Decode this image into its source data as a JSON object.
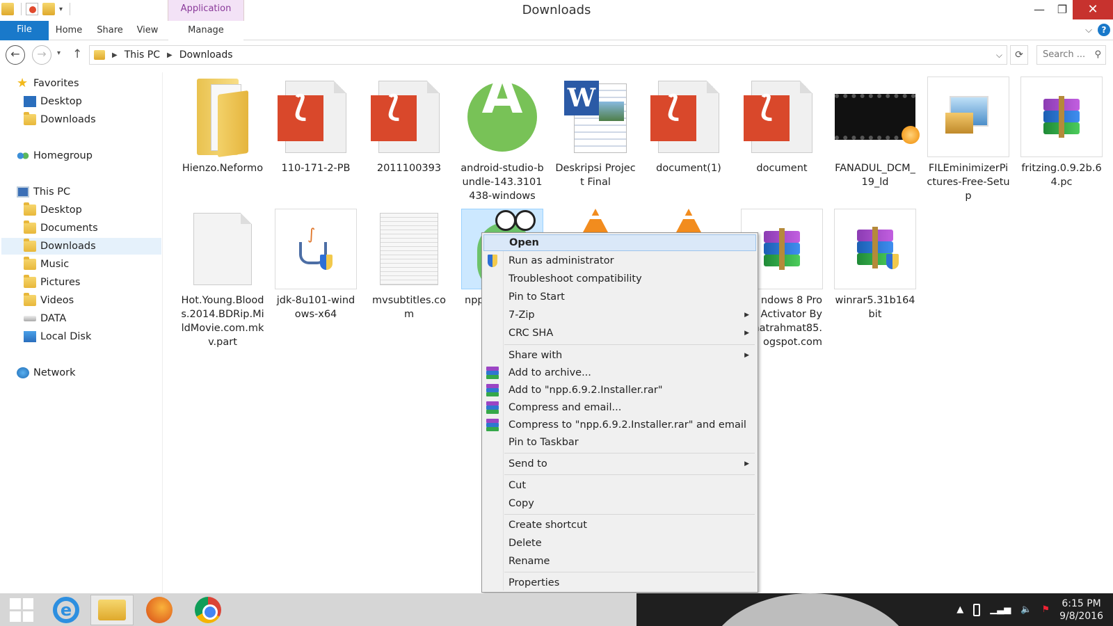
{
  "window": {
    "title": "Downloads",
    "context_tab_group": "Application Tools",
    "controls": {
      "minimize": "—",
      "maximize": "❐",
      "close": "✕"
    }
  },
  "ribbon": {
    "tabs": [
      {
        "label": "File"
      },
      {
        "label": "Home"
      },
      {
        "label": "Share"
      },
      {
        "label": "View"
      },
      {
        "label": "Manage"
      }
    ],
    "help": "?"
  },
  "address": {
    "breadcrumbs": [
      "This PC",
      "Downloads"
    ],
    "search_placeholder": "Search ..."
  },
  "sidebar": {
    "favorites": {
      "label": "Favorites",
      "items": [
        "Desktop",
        "Downloads"
      ]
    },
    "homegroup": "Homegroup",
    "thispc": {
      "label": "This PC",
      "items": [
        "Desktop",
        "Documents",
        "Downloads",
        "Music",
        "Pictures",
        "Videos",
        "DATA",
        "Local Disk"
      ]
    },
    "network": "Network",
    "selected": "Downloads"
  },
  "files": {
    "row1": [
      {
        "name": "Hienzo.Neformo",
        "icon": "folder-icon"
      },
      {
        "name": "110-171-2-PB",
        "icon": "pdf-icon"
      },
      {
        "name": "2011100393",
        "icon": "pdf-icon"
      },
      {
        "name": "android-studio-bundle-143.3101438-windows",
        "icon": "android-studio-icon"
      },
      {
        "name": "Deskripsi Project Final",
        "icon": "word-icon"
      },
      {
        "name": "document(1)",
        "icon": "pdf-icon"
      },
      {
        "name": "document",
        "icon": "pdf-icon"
      },
      {
        "name": "FANADUL_DCM_19_ld",
        "icon": "video-icon"
      },
      {
        "name": "FILEminimizerPictures-Free-Setup",
        "icon": "installer-icon"
      },
      {
        "name": "fritzing.0.9.2b.64.pc",
        "icon": "winrar-archive-icon"
      }
    ],
    "row2": [
      {
        "name": "Hot.Young.Bloods.2014.BDRip.MildMovie.com.mkv.part",
        "icon": "blank-file-icon"
      },
      {
        "name": "jdk-8u101-windows-x64",
        "icon": "java-icon"
      },
      {
        "name": "mvsubtitles.com",
        "icon": "text-file-icon"
      },
      {
        "name": "npp.",
        "icon": "notepad-plus-plus-icon"
      },
      {
        "name": "",
        "icon": "vlc-icon"
      },
      {
        "name": "",
        "icon": "vlc-icon"
      },
      {
        "name": "ndows 8 Pro\nal Activator By\nmatrahmat85.\nogspot.com",
        "icon": "winrar-archive-icon"
      },
      {
        "name": "winrar5.31b164bit",
        "icon": "winrar-installer-icon"
      }
    ]
  },
  "context_menu": {
    "items": [
      {
        "label": "Open"
      },
      {
        "label": "Run as administrator"
      },
      {
        "label": "Troubleshoot compatibility"
      },
      {
        "label": "Pin to Start"
      },
      {
        "label": "7-Zip"
      },
      {
        "label": "CRC SHA"
      },
      {
        "label": "Share with"
      },
      {
        "label": "Add to archive..."
      },
      {
        "label": "Add to \"npp.6.9.2.Installer.rar\""
      },
      {
        "label": "Compress and email..."
      },
      {
        "label": "Compress to \"npp.6.9.2.Installer.rar\" and email"
      },
      {
        "label": "Pin to Taskbar"
      },
      {
        "label": "Send to"
      },
      {
        "label": "Cut"
      },
      {
        "label": "Copy"
      },
      {
        "label": "Create shortcut"
      },
      {
        "label": "Delete"
      },
      {
        "label": "Rename"
      },
      {
        "label": "Properties"
      }
    ],
    "highlighted": "Open"
  },
  "taskbar": {
    "pinned": [
      "start-button",
      "internet-explorer",
      "file-explorer",
      "firefox",
      "chrome"
    ],
    "clock": {
      "time": "6:15 PM",
      "date": "9/8/2016"
    }
  },
  "colors": {
    "accent": "#1979ca",
    "app_tools": "#f3e2f6",
    "close": "#c7322e",
    "selection": "#cce8ff"
  }
}
